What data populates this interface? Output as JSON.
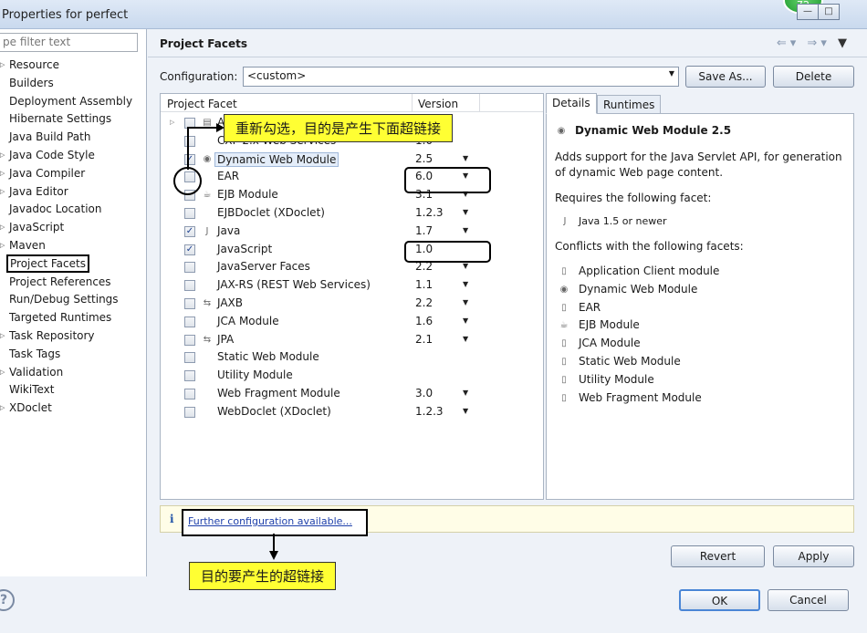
{
  "window": {
    "title": "Properties for perfect",
    "badge": "72"
  },
  "filter": {
    "placeholder": "pe filter text"
  },
  "sidebar": {
    "items": [
      {
        "label": "Resource",
        "expandable": true
      },
      {
        "label": "Builders"
      },
      {
        "label": "Deployment Assembly"
      },
      {
        "label": "Hibernate Settings"
      },
      {
        "label": "Java Build Path"
      },
      {
        "label": "Java Code Style",
        "expandable": true
      },
      {
        "label": "Java Compiler",
        "expandable": true
      },
      {
        "label": "Java Editor",
        "expandable": true
      },
      {
        "label": "Javadoc Location"
      },
      {
        "label": "JavaScript",
        "expandable": true
      },
      {
        "label": "Maven",
        "expandable": true
      },
      {
        "label": "Project Facets",
        "selected": true
      },
      {
        "label": "Project References"
      },
      {
        "label": "Run/Debug Settings"
      },
      {
        "label": "Targeted Runtimes"
      },
      {
        "label": "Task Repository",
        "expandable": true
      },
      {
        "label": "Task Tags"
      },
      {
        "label": "Validation",
        "expandable": true
      },
      {
        "label": "WikiText"
      },
      {
        "label": "XDoclet",
        "expandable": true
      }
    ]
  },
  "page": {
    "title": "Project Facets"
  },
  "configuration": {
    "label": "Configuration:",
    "value": "<custom>",
    "save_as": "Save As...",
    "delete": "Delete"
  },
  "facets": {
    "col_facet": "Project Facet",
    "col_version": "Version",
    "rows": [
      {
        "name": "Axis2 Web Services",
        "version": "",
        "checked": false,
        "expander": true,
        "icon": "folder-icon"
      },
      {
        "name": "CXF 2.x Web Services",
        "version": "1.0",
        "checked": false,
        "icon": "blank-icon"
      },
      {
        "name": "Dynamic Web Module",
        "version": "2.5",
        "checked": true,
        "dropdown": true,
        "icon": "globe-icon",
        "highlight": true
      },
      {
        "name": "EAR",
        "version": "6.0",
        "checked": false,
        "dropdown": true,
        "icon": "blank-icon"
      },
      {
        "name": "EJB Module",
        "version": "3.1",
        "checked": false,
        "dropdown": true,
        "icon": "bean-icon"
      },
      {
        "name": "EJBDoclet (XDoclet)",
        "version": "1.2.3",
        "checked": false,
        "dropdown": true,
        "icon": "blank-icon"
      },
      {
        "name": "Java",
        "version": "1.7",
        "checked": true,
        "dropdown": true,
        "icon": "java-file-icon"
      },
      {
        "name": "JavaScript",
        "version": "1.0",
        "checked": true,
        "icon": "blank-icon"
      },
      {
        "name": "JavaServer Faces",
        "version": "2.2",
        "checked": false,
        "dropdown": true,
        "icon": "blank-icon"
      },
      {
        "name": "JAX-RS (REST Web Services)",
        "version": "1.1",
        "checked": false,
        "dropdown": true,
        "icon": "blank-icon"
      },
      {
        "name": "JAXB",
        "version": "2.2",
        "checked": false,
        "dropdown": true,
        "icon": "arrows-icon"
      },
      {
        "name": "JCA Module",
        "version": "1.6",
        "checked": false,
        "dropdown": true,
        "icon": "blank-icon"
      },
      {
        "name": "JPA",
        "version": "2.1",
        "checked": false,
        "dropdown": true,
        "icon": "arrows-icon"
      },
      {
        "name": "Static Web Module",
        "version": "",
        "checked": false,
        "icon": "blank-icon"
      },
      {
        "name": "Utility Module",
        "version": "",
        "checked": false,
        "icon": "blank-icon"
      },
      {
        "name": "Web Fragment Module",
        "version": "3.0",
        "checked": false,
        "dropdown": true,
        "icon": "blank-icon"
      },
      {
        "name": "WebDoclet (XDoclet)",
        "version": "1.2.3",
        "checked": false,
        "dropdown": true,
        "icon": "blank-icon"
      }
    ]
  },
  "details": {
    "tab_details": "Details",
    "tab_runtimes": "Runtimes",
    "title": "Dynamic Web Module 2.5",
    "description": "Adds support for the Java Servlet API, for generation of dynamic Web page content.",
    "requires_label": "Requires the following facet:",
    "requires_item": "Java 1.5 or newer",
    "conflicts_label": "Conflicts with the following facets:",
    "conflicts": [
      {
        "label": "Application Client module",
        "icon": "page-icon"
      },
      {
        "label": "Dynamic Web Module",
        "icon": "globe-icon"
      },
      {
        "label": "EAR",
        "icon": "page-icon"
      },
      {
        "label": "EJB Module",
        "icon": "bean-icon"
      },
      {
        "label": "JCA Module",
        "icon": "page-icon"
      },
      {
        "label": "Static Web Module",
        "icon": "page-icon"
      },
      {
        "label": "Utility Module",
        "icon": "page-icon"
      },
      {
        "label": "Web Fragment Module",
        "icon": "page-icon"
      }
    ]
  },
  "info": {
    "icon": "i",
    "link": "Further configuration available..."
  },
  "buttons": {
    "revert": "Revert",
    "apply": "Apply",
    "ok": "OK",
    "cancel": "Cancel"
  },
  "annotations": {
    "top": "重新勾选，目的是产生下面超链接",
    "bottom": "目的要产生的超链接"
  },
  "colors": {
    "callout": "#ffff33",
    "link": "#1d3faa",
    "checkmark": "#1b3f8f"
  }
}
